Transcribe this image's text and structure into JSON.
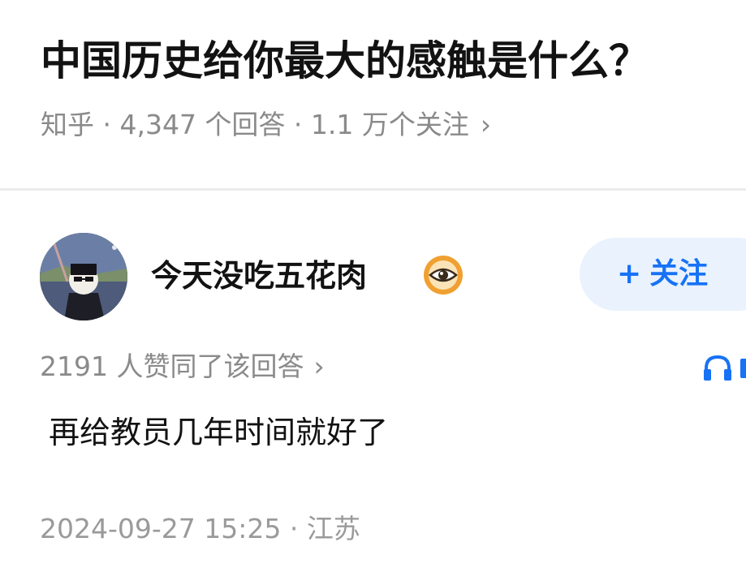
{
  "question": {
    "title": "中国历史给你最大的感触是什么？",
    "meta": "知乎 · 4,347 个回答 · 1.1 万个关注",
    "chevron_icon": "chevron-right-icon"
  },
  "answer": {
    "author": {
      "name": "今天没吃五花肉",
      "avatar_icon": "user-avatar",
      "badge_icon": "eye-badge-icon",
      "badge_color": "#f0a030"
    },
    "follow_button": {
      "plus": "+",
      "label": "关注",
      "color": "#1772f6",
      "background": "#e9f2fd"
    },
    "upvote_text": "2191 人赞同了该回答",
    "audio_icon": "headphone-icon",
    "content": "再给教员几年时间就好了",
    "footer": "2024-09-27 15:25 · 江苏"
  }
}
